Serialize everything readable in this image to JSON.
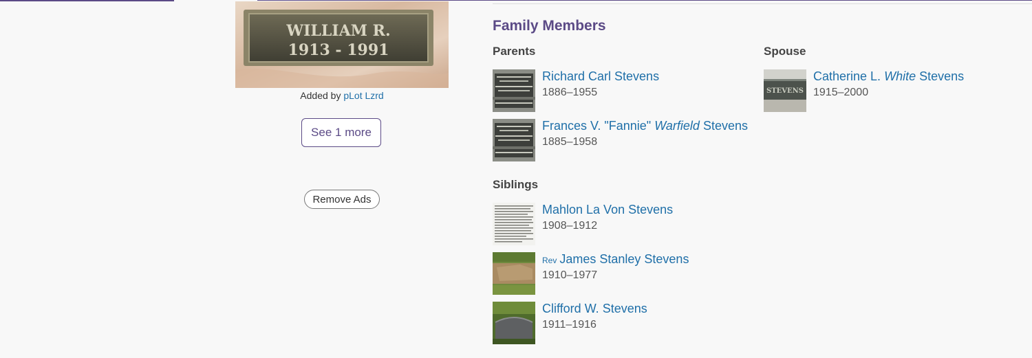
{
  "photo": {
    "alt": "Grave marker plaque",
    "plaque_line1": "WILLIAM R.",
    "plaque_line2": "1913 - 1991"
  },
  "added_by": {
    "prefix": "Added by",
    "user": "pLot Lzrd"
  },
  "see_more_label": "See 1 more",
  "remove_ads_label": "Remove Ads",
  "family": {
    "heading": "Family Members",
    "parents_heading": "Parents",
    "spouse_heading": "Spouse",
    "siblings_heading": "Siblings",
    "parents": [
      {
        "first": "Richard Carl Stevens",
        "maiden": "",
        "last": "",
        "prefix": "",
        "dates": "1886–1955",
        "thumb": "plaque-icon"
      },
      {
        "first": "Frances V. \"Fannie\"",
        "maiden": "Warfield",
        "last": "Stevens",
        "prefix": "",
        "dates": "1885–1958",
        "thumb": "plaque-icon"
      }
    ],
    "spouse": [
      {
        "first": "Catherine L.",
        "maiden": "White",
        "last": "Stevens",
        "prefix": "",
        "dates": "1915–2000",
        "thumb": "marker-icon"
      }
    ],
    "siblings": [
      {
        "first": "Mahlon La Von Stevens",
        "maiden": "",
        "last": "",
        "prefix": "",
        "dates": "1908–1912",
        "thumb": "newspaper-icon"
      },
      {
        "first": "James Stanley Stevens",
        "maiden": "",
        "last": "",
        "prefix": "Rev",
        "dates": "1910–1977",
        "thumb": "grass-icon"
      },
      {
        "first": "Clifford W. Stevens",
        "maiden": "",
        "last": "",
        "prefix": "",
        "dates": "1911–1916",
        "thumb": "headstone-icon"
      }
    ]
  },
  "colors": {
    "accent": "#5b4a86",
    "link": "#1f6fa8",
    "background": "#f8f8f8"
  }
}
